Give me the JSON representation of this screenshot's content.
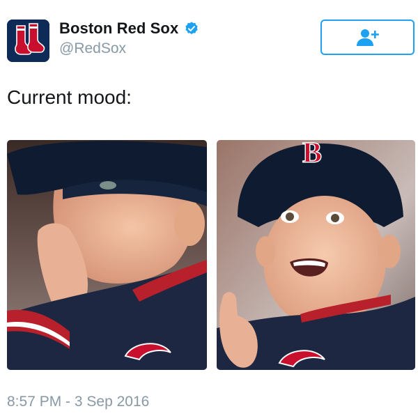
{
  "account": {
    "display_name": "Boston Red Sox",
    "handle": "@RedSox",
    "verified": true,
    "avatar_icon": "red-sox-logo-icon",
    "verified_icon": "verified-badge-icon"
  },
  "follow_button": {
    "icon": "add-user-icon",
    "color": "#1da1f2"
  },
  "tweet": {
    "text": "Current mood:",
    "timestamp": "8:57 PM - 3 Sep 2016"
  },
  "media": [
    {
      "kind": "photo",
      "subject": "boy-eating-in-red-sox-cap"
    },
    {
      "kind": "photo",
      "subject": "boy-excited-thumbs-up"
    }
  ],
  "colors": {
    "text_primary": "#14171a",
    "text_secondary": "#8899a6",
    "accent": "#1da1f2",
    "team_navy": "#0d2b56",
    "team_red": "#c8102e"
  }
}
